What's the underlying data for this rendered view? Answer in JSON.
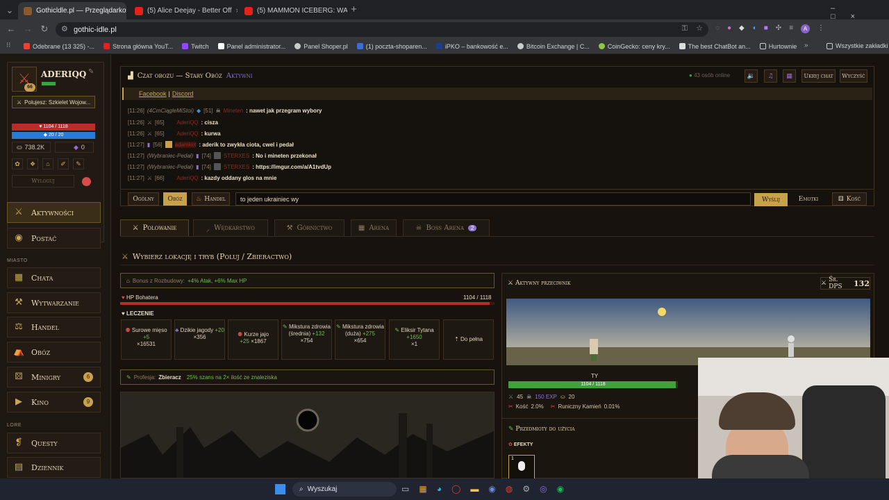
{
  "browser": {
    "tabs": [
      {
        "label": "Gothicldle.pl — Przeglądarkow",
        "active": true
      },
      {
        "label": "(5) Alice Deejay - Better Off",
        "active": false
      },
      {
        "label": "(5) MAMMON ICEBERG: WARST",
        "active": false
      }
    ],
    "url": "gothic-idle.pl",
    "bookmarks": [
      "Odebrane (13 325) -...",
      "Strona główna YouT...",
      "Twitch",
      "Panel administrator...",
      "Panel Shoper.pl",
      "(1) poczta-shoparen...",
      "iPKO – bankowość e...",
      "Bitcoin Exchange | C...",
      "CoinGecko: ceny kry...",
      "The best ChatBot an...",
      "Hurtownie"
    ],
    "all_bookmarks": "Wszystkie zakładki"
  },
  "profile": {
    "name": "ADERIQQ",
    "level": "66",
    "quest": "Polujesz: Szkielet Wojow...",
    "hp": "1104 / 1118",
    "mana": "20 / 20",
    "gold": "738.2K",
    "gems": "0",
    "logout": "Wyloguj"
  },
  "nav": {
    "activities": "Aktywności",
    "character": "Postać",
    "city_label": "MIASTO",
    "hut": "Chata",
    "crafting": "Wytwarzanie",
    "trade": "Handel",
    "camp": "Obóz",
    "minigames": "Minigry",
    "minigames_badge": "6",
    "cinema": "Kino",
    "cinema_badge": "9",
    "lore_label": "LORE",
    "quests": "Questy",
    "journal": "Dziennik"
  },
  "chat": {
    "title": "Czat obozu — Stary Obóz",
    "active_label": "Aktywni",
    "online": "43 osób online",
    "hide": "Ukryj chat",
    "clear": "Wyczyść",
    "facebook": "Facebook",
    "sep": "|",
    "discord": "Discord",
    "messages": [
      {
        "time": "[11:26]",
        "tag": "(4CmCiągleMiStoi)",
        "lvl": "[51]",
        "user": "Mineten",
        "text": ": nawet jak przegram wybory"
      },
      {
        "time": "[11:26]",
        "tag": "",
        "lvl": "[65]",
        "user": "AderiQQ",
        "text": ": cisza"
      },
      {
        "time": "[11:26]",
        "tag": "",
        "lvl": "[65]",
        "user": "AderiQQ",
        "text": ": kurwa"
      },
      {
        "time": "[11:27]",
        "tag": "",
        "lvl": "[56]",
        "user": "adamkot",
        "text": ": aderik to zwykła ciota, cwel i pedał"
      },
      {
        "time": "[11:27]",
        "tag": "(Wybraniec-Pedał)",
        "lvl": "[74]",
        "user": "STERXES",
        "text": ": No i mineten przekonał"
      },
      {
        "time": "[11:27]",
        "tag": "(Wybraniec-Pedał)",
        "lvl": "[74]",
        "user": "STERXES",
        "text": ": https://imgur.com/a/A1tvdUp"
      },
      {
        "time": "[11:27]",
        "tag": "",
        "lvl": "[66]",
        "user": "AderiQQ",
        "text": ": kazdy oddany glos na mnie"
      }
    ],
    "channels": [
      "Ogólny",
      "Obóz",
      "Handel"
    ],
    "input_value": "to jeden ukrainiec wy",
    "send": "Wyślij",
    "emotes": "Emotki",
    "dice": "Kość"
  },
  "game_tabs": [
    {
      "label": "Polowanie"
    },
    {
      "label": "Wędkarstwo"
    },
    {
      "label": "Górnictwo"
    },
    {
      "label": "Arena"
    },
    {
      "label": "Boss Arena",
      "badge": "2"
    }
  ],
  "hunt": {
    "heading": "Wybierz lokację i tryb (Poluj / Zbieractwo)",
    "bonus_label": "Bonus z Rozbudowy:",
    "bonus_value": "+4% Atak, +6% Max HP",
    "hp_label": "HP Bohatera",
    "hp_value": "1104 / 1118",
    "hp_fraction": 0.987,
    "heal_label": "LECZENIE",
    "heals": [
      {
        "name": "Surowe mięso",
        "bonus": "+5",
        "count": "×16531"
      },
      {
        "name": "Dzikie jagody",
        "bonus": "+20",
        "count": "×356"
      },
      {
        "name": "Kurze jajo",
        "bonus": "+25",
        "count": "×1867"
      },
      {
        "name": "Mikstura zdrowia (średnia)",
        "bonus": "+132",
        "count": "×754"
      },
      {
        "name": "Mikstura zdrowia (duża)",
        "bonus": "+275",
        "count": "×654"
      },
      {
        "name": "Eliksir Tytana",
        "bonus": "+1650",
        "count": "×1"
      }
    ],
    "full": "⇡ Do pełna",
    "prof_label": "Profesja:",
    "prof_name": "Zbieracz",
    "prof_desc": "25% szans na 2× ilość ze znaleziska"
  },
  "enemy": {
    "title": "Aktywny przeciwnik",
    "dps_label": "Śr. DPS",
    "dps_value": "132",
    "you": "TY",
    "player_hp": "1104 / 1118",
    "player_hp_fraction": 0.987,
    "lvl": "45",
    "exp": "150 EXP",
    "gold": "20",
    "bone_label": "Kość",
    "bone_value": "2.0%",
    "rune_label": "Runiczny Kamień",
    "rune_value": "0.01%"
  },
  "items": {
    "title": "Przedmioty do użycia",
    "effects": "EFEKTY",
    "slot_count": "1"
  },
  "taskbar": {
    "search": "Wyszukaj"
  }
}
